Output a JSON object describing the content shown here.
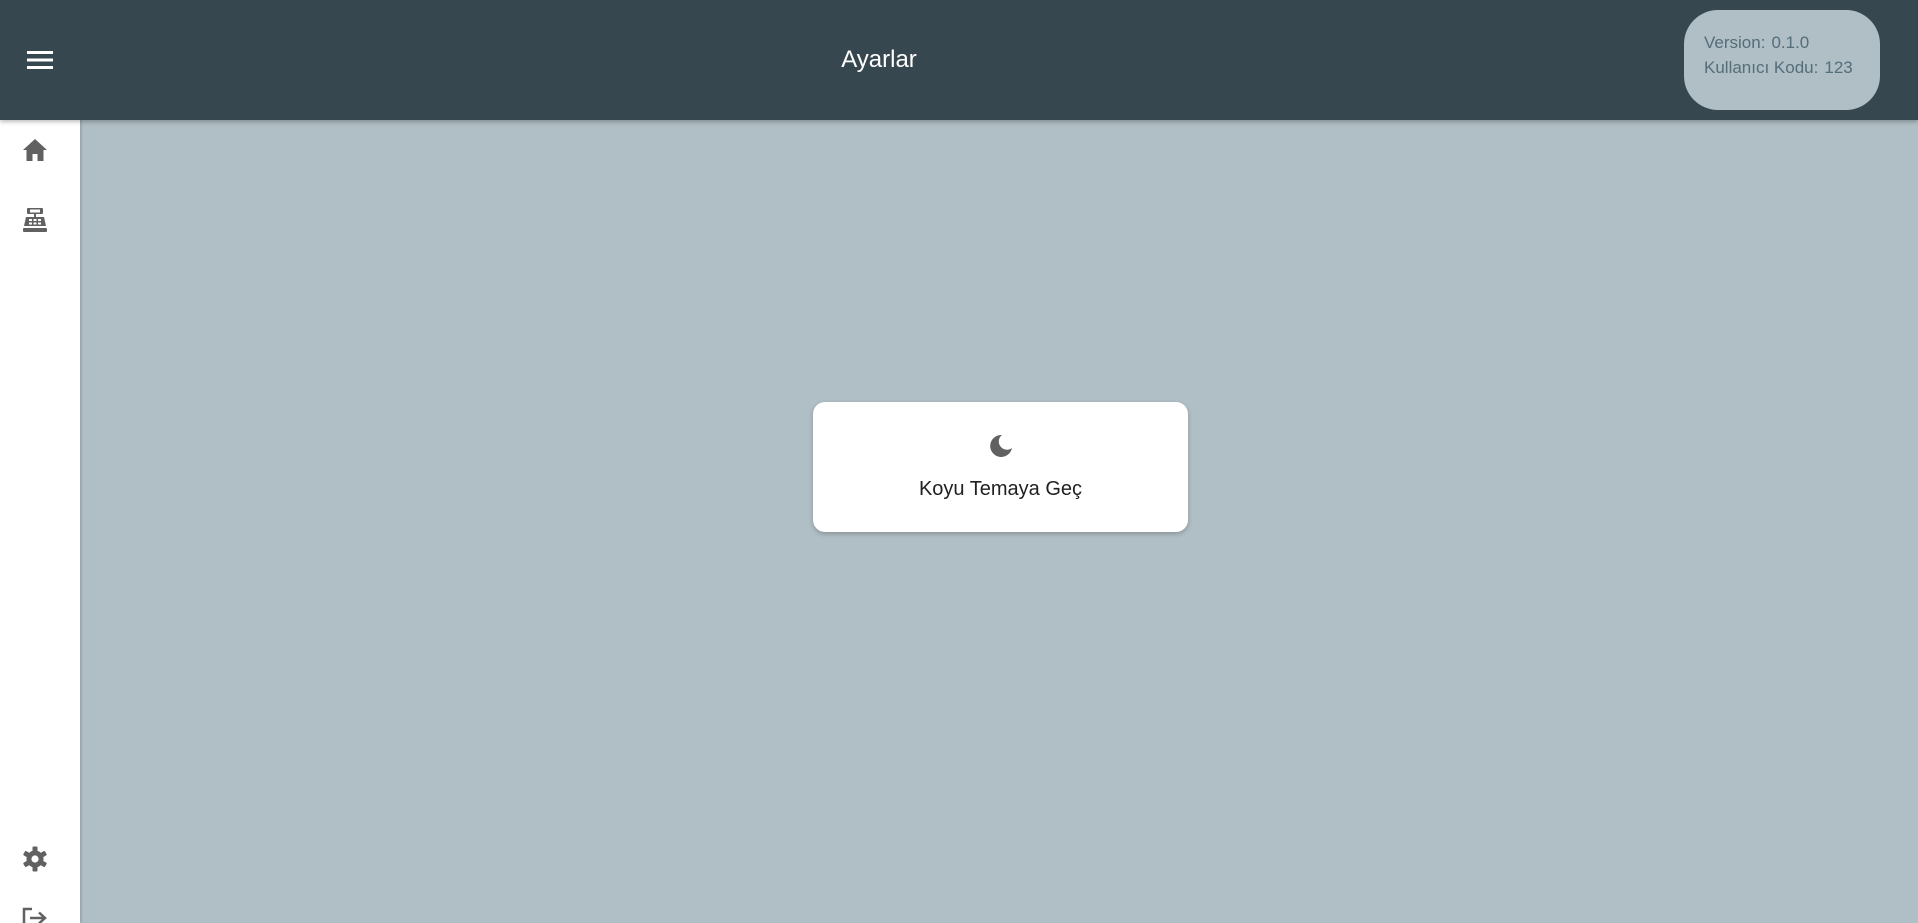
{
  "header": {
    "title": "Ayarlar",
    "menu_icon": "menu-icon",
    "info": {
      "version_label": "Version:",
      "version_value": "0.1.0",
      "user_code_label": "Kullanıcı Kodu:",
      "user_code_value": "123"
    }
  },
  "sidebar": {
    "top_items": [
      {
        "name": "home",
        "icon": "home-icon"
      },
      {
        "name": "cash-register",
        "icon": "cash-register-icon"
      }
    ],
    "bottom_items": [
      {
        "name": "settings",
        "icon": "gear-icon"
      },
      {
        "name": "logout",
        "icon": "logout-icon"
      }
    ]
  },
  "main": {
    "theme_card": {
      "icon": "moon-icon",
      "label": "Koyu Temaya Geç"
    }
  },
  "colors": {
    "topbar": "#37474f",
    "background": "#b0bec5",
    "info_text": "#546e7a",
    "icon_gray": "#616161",
    "card": "#ffffff"
  }
}
